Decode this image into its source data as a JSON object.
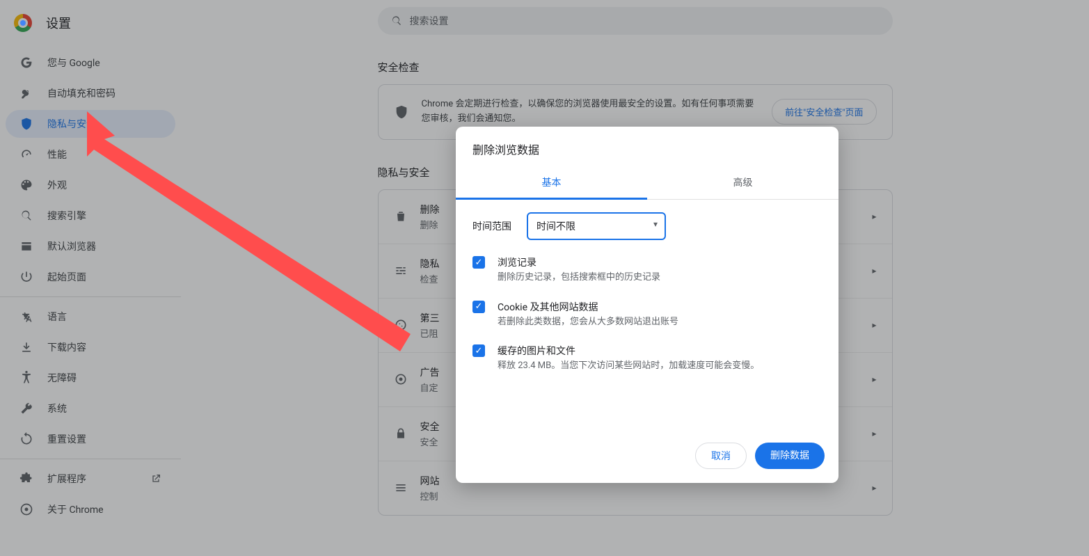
{
  "header": {
    "title": "设置"
  },
  "search": {
    "placeholder": "搜索设置"
  },
  "sidebar": {
    "items_top": [
      {
        "label": "您与 Google"
      },
      {
        "label": "自动填充和密码"
      },
      {
        "label": "隐私与安全"
      },
      {
        "label": "性能"
      },
      {
        "label": "外观"
      },
      {
        "label": "搜索引擎"
      },
      {
        "label": "默认浏览器"
      },
      {
        "label": "起始页面"
      }
    ],
    "items_mid": [
      {
        "label": "语言"
      },
      {
        "label": "下载内容"
      },
      {
        "label": "无障碍"
      },
      {
        "label": "系统"
      },
      {
        "label": "重置设置"
      }
    ],
    "items_bot": [
      {
        "label": "扩展程序"
      },
      {
        "label": "关于 Chrome"
      }
    ]
  },
  "safety": {
    "heading": "安全检查",
    "text": "Chrome 会定期进行检查，以确保您的浏览器使用最安全的设置。如有任何事项需要您审核，我们会通知您。",
    "button": "前往\"安全检查\"页面"
  },
  "privacy": {
    "heading": "隐私与安全",
    "rows": [
      {
        "t": "删除",
        "s": "删除"
      },
      {
        "t": "隐私",
        "s": "检查"
      },
      {
        "t": "第三",
        "s": "已阻"
      },
      {
        "t": "广告",
        "s": "自定"
      },
      {
        "t": "安全",
        "s": "安全"
      },
      {
        "t": "网站",
        "s": "控制"
      }
    ]
  },
  "dialog": {
    "title": "删除浏览数据",
    "tabs": {
      "basic": "基本",
      "advanced": "高级"
    },
    "range_label": "时间范围",
    "range_value": "时间不限",
    "options": [
      {
        "title": "浏览记录",
        "sub": "删除历史记录，包括搜索框中的历史记录",
        "checked": true
      },
      {
        "title": "Cookie 及其他网站数据",
        "sub": "若删除此类数据，您会从大多数网站退出账号",
        "checked": true
      },
      {
        "title": "缓存的图片和文件",
        "sub": "释放 23.4 MB。当您下次访问某些网站时，加载速度可能会变慢。",
        "checked": true
      }
    ],
    "cancel": "取消",
    "confirm": "删除数据"
  }
}
